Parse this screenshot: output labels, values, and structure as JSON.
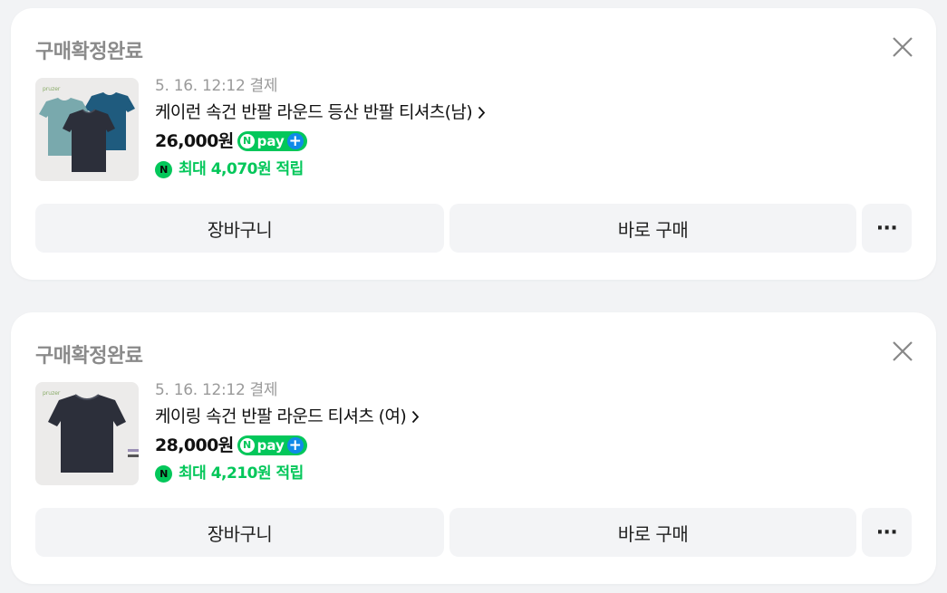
{
  "orders": [
    {
      "status": "구매확정완료",
      "date": "5. 16. 12:12 결제",
      "product_name": "케이런 속건 반팔 라운드 등산 반팔 티셔츠(남)",
      "price": "26,000원",
      "npay": {
        "letter": "N",
        "text": "pay",
        "plus": "+"
      },
      "points": "최대 4,070원 적립",
      "points_badge": "N",
      "cart_button": "장바구니",
      "buy_button": "바로 구매",
      "more_button": "···",
      "thumbnail_brand": "pruzer",
      "thumbnail_colors": [
        "#79a9ad",
        "#1f5b7e",
        "#2c2f3a"
      ]
    },
    {
      "status": "구매확정완료",
      "date": "5. 16. 12:12 결제",
      "product_name": "케이링 속건 반팔 라운드 티셔츠 (여)",
      "price": "28,000원",
      "npay": {
        "letter": "N",
        "text": "pay",
        "plus": "+"
      },
      "points": "최대 4,210원 적립",
      "points_badge": "N",
      "cart_button": "장바구니",
      "buy_button": "바로 구매",
      "more_button": "···",
      "thumbnail_brand": "pruzer",
      "thumbnail_colors": [
        "#2c2f3a"
      ]
    }
  ],
  "colors": {
    "npay_green": "#03c75a",
    "npay_plus_blue": "#0f8ae8",
    "status_gray": "#8a8a8a",
    "button_bg": "#f3f4f6"
  },
  "icons": [
    "close-icon",
    "chevron-right-icon",
    "npay-logo",
    "naver-points-icon",
    "more-icon"
  ]
}
